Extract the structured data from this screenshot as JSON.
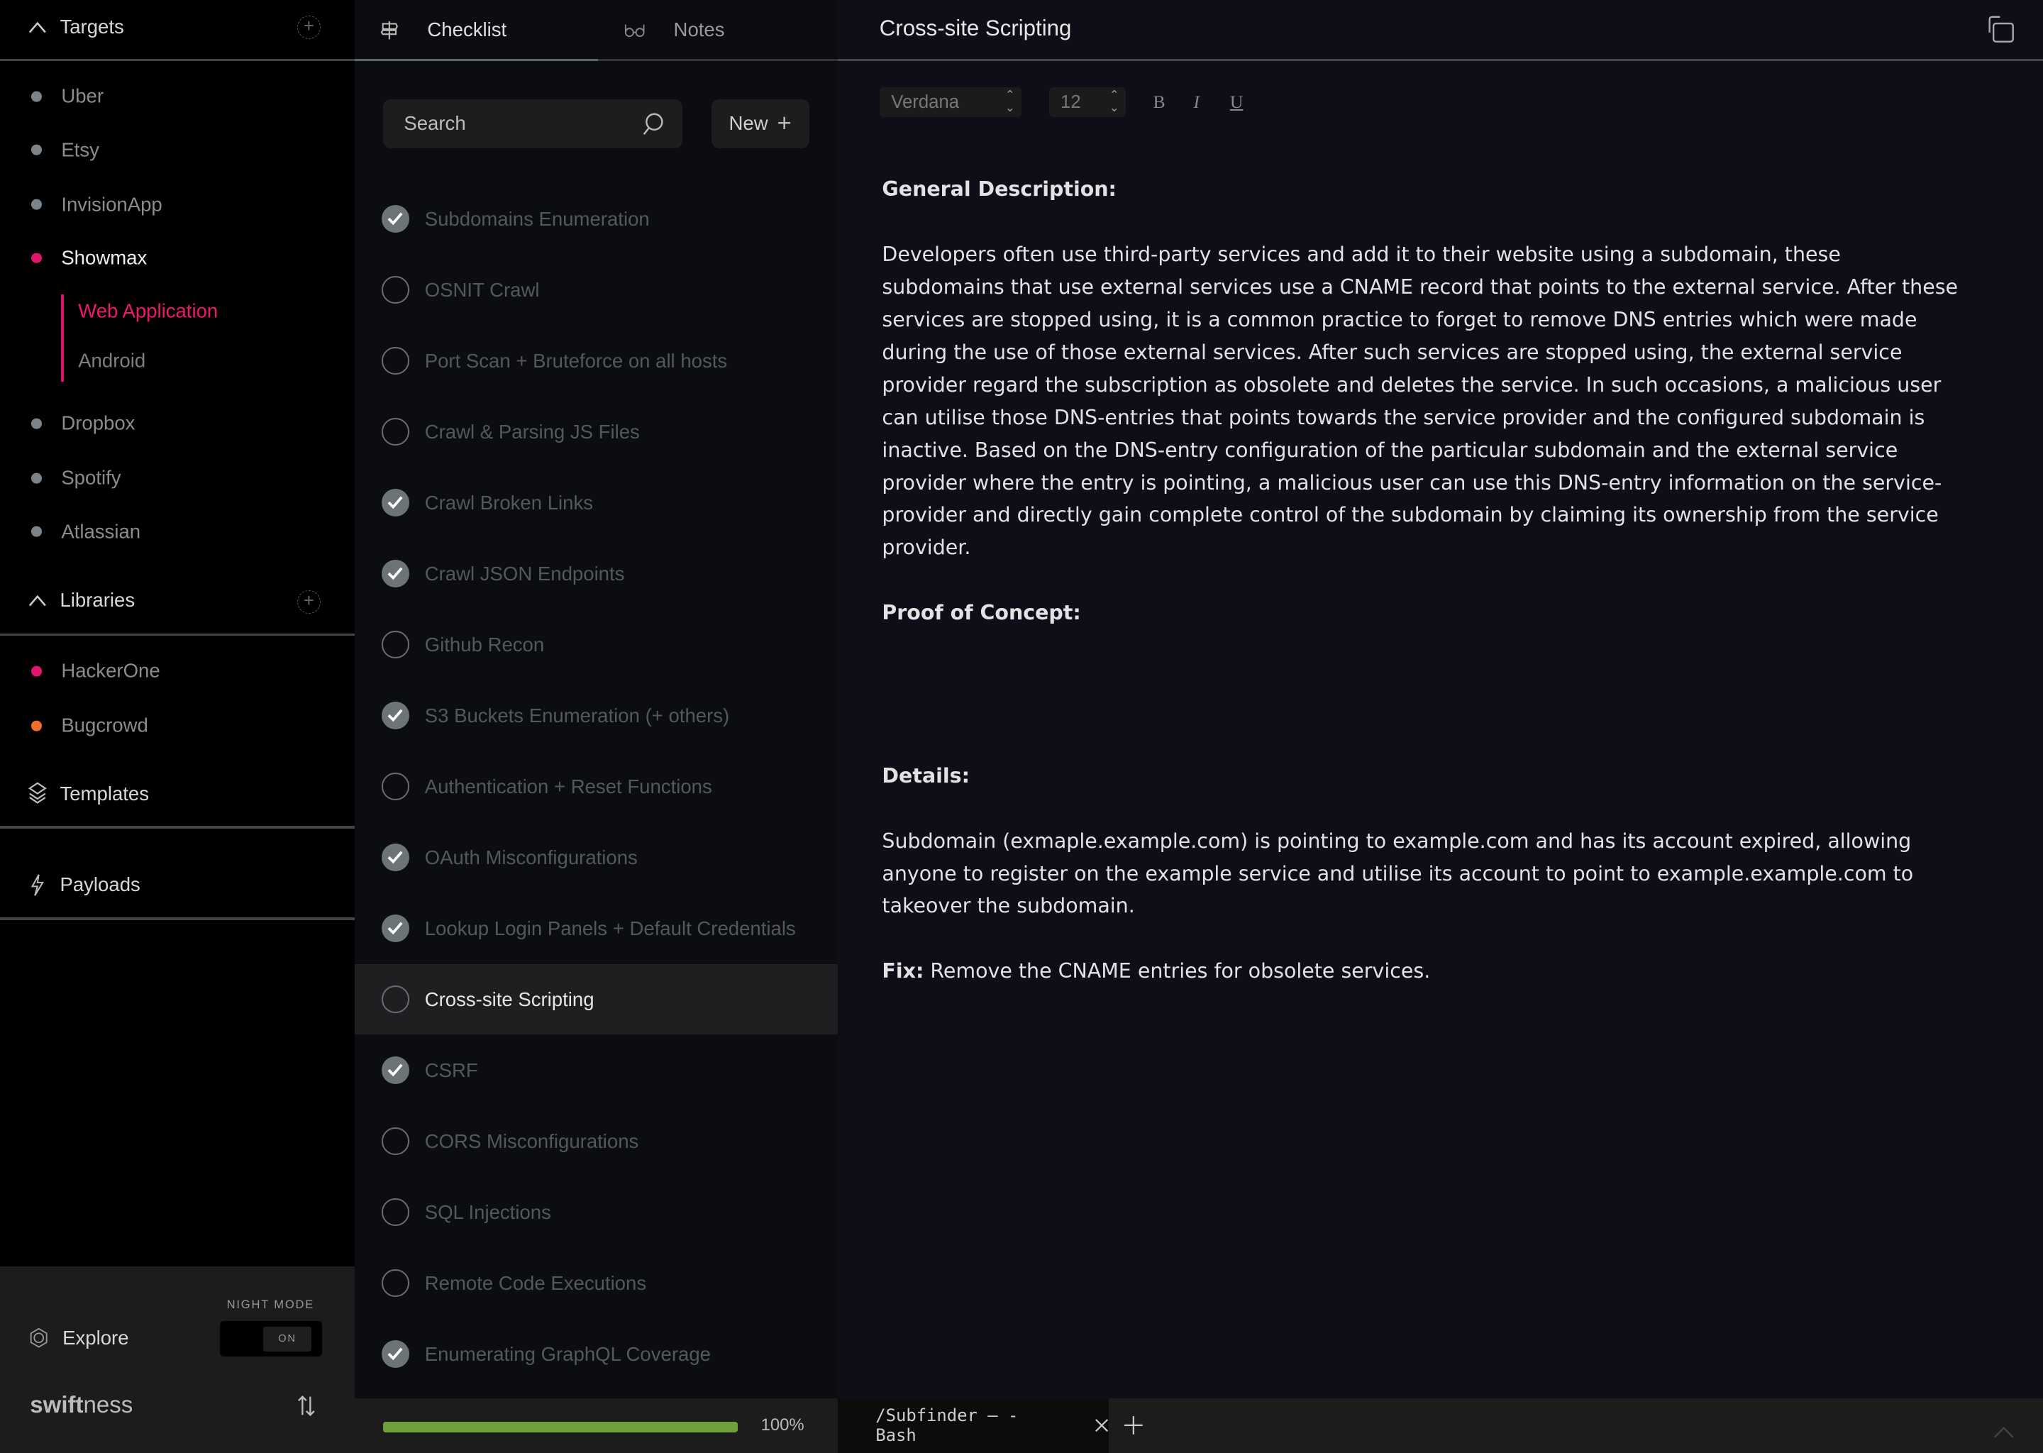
{
  "sidebar": {
    "targets_header": "Targets",
    "targets": [
      {
        "label": "Uber",
        "color": "#7d8489",
        "active": false
      },
      {
        "label": "Etsy",
        "color": "#7d8489",
        "active": false
      },
      {
        "label": "InvisionApp",
        "color": "#7d8489",
        "active": false
      },
      {
        "label": "Showmax",
        "color": "#e0156e",
        "active": true
      }
    ],
    "sub_items": [
      {
        "label": "Web Application",
        "active": true
      },
      {
        "label": "Android",
        "active": false
      }
    ],
    "targets_more": [
      {
        "label": "Dropbox",
        "color": "#7d8489"
      },
      {
        "label": "Spotify",
        "color": "#7d8489"
      },
      {
        "label": "Atlassian",
        "color": "#7d8489"
      }
    ],
    "libraries_header": "Libraries",
    "libraries": [
      {
        "label": "HackerOne",
        "color": "#e0156e"
      },
      {
        "label": "Bugcrowd",
        "color": "#f26c2c"
      }
    ],
    "templates": "Templates",
    "payloads": "Payloads",
    "explore": "Explore",
    "night_mode_label": "NIGHT MODE",
    "night_mode_state": "ON",
    "logo_bold": "swift",
    "logo_light": "ness"
  },
  "checklist": {
    "tabs": [
      {
        "label": "Checklist",
        "active": true
      },
      {
        "label": "Notes",
        "active": false
      }
    ],
    "search_placeholder": "Search",
    "new_label": "New",
    "items": [
      {
        "label": "Subdomains Enumeration",
        "checked": true
      },
      {
        "label": "OSNIT Crawl",
        "checked": false
      },
      {
        "label": "Port Scan + Bruteforce on all hosts",
        "checked": false
      },
      {
        "label": "Crawl & Parsing JS Files",
        "checked": false
      },
      {
        "label": "Crawl Broken Links",
        "checked": true
      },
      {
        "label": "Crawl JSON Endpoints",
        "checked": true
      },
      {
        "label": "Github Recon",
        "checked": false
      },
      {
        "label": "S3 Buckets Enumeration (+ others)",
        "checked": true
      },
      {
        "label": "Authentication + Reset Functions",
        "checked": false
      },
      {
        "label": "OAuth Misconfigurations",
        "checked": true
      },
      {
        "label": "Lookup Login Panels + Default Credentials",
        "checked": true
      },
      {
        "label": "Cross-site Scripting",
        "checked": false,
        "selected": true
      },
      {
        "label": "CSRF",
        "checked": true
      },
      {
        "label": "CORS Misconfigurations",
        "checked": false
      },
      {
        "label": "SQL Injections",
        "checked": false
      },
      {
        "label": "Remote Code Executions",
        "checked": false
      },
      {
        "label": "Enumerating GraphQL Coverage",
        "checked": true
      }
    ],
    "progress_percent": 100,
    "progress_label": "100%",
    "progress_color": "#6ea03c"
  },
  "editor": {
    "title": "Cross-site Scripting",
    "font": "Verdana",
    "size": "12",
    "bold": "B",
    "italic": "I",
    "underline": "U",
    "general_heading": "General Description:",
    "general_text": "Developers often use third-party services and add it to their website using a subdomain, these subdomains that use external services use a CNAME record that points to the external service. After these services are stopped using, it is a common practice to forget to remove DNS entries which were made during the use of those external services. After such services are stopped using, the external service provider regard the subscription as obsolete and deletes the service. In such occasions, a malicious user can utilise those DNS-entries that points towards the service provider and the configured subdomain is inactive. Based on the DNS-entry configuration of the particular subdomain and the external service provider where the entry is pointing, a malicious user can use this DNS-entry information on the service-provider and directly gain complete control of the subdomain by claiming its ownership from the service provider.",
    "poc_heading": "Proof of Concept:",
    "details_heading": "Details:",
    "details_text": "Subdomain (exmaple.example.com) is pointing to example.com and has its account expired, allowing anyone to register on the example service and utilise its account to point to example.example.com to takeover the subdomain.",
    "fix_label": "Fix:",
    "fix_text": " Remove the CNAME entries for obsolete services."
  },
  "terminal": {
    "tab_label": "/Subfinder — - Bash"
  }
}
